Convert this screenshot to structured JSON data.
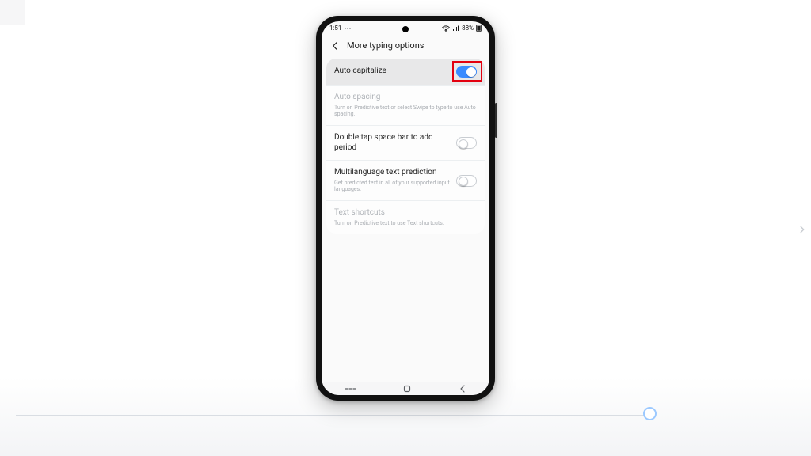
{
  "status_bar": {
    "time": "1:51",
    "battery_percent": "88%"
  },
  "header": {
    "title": "More typing options"
  },
  "settings": [
    {
      "title": "Auto capitalize",
      "subtitle": "",
      "toggle_on": true,
      "highlighted": true,
      "red_box": true,
      "disabled": false
    },
    {
      "title": "Auto spacing",
      "subtitle": "Turn on Predictive text or select Swipe to type to use Auto spacing.",
      "toggle_on": null,
      "highlighted": false,
      "red_box": false,
      "disabled": true
    },
    {
      "title": "Double tap space bar to add period",
      "subtitle": "",
      "toggle_on": false,
      "highlighted": false,
      "red_box": false,
      "disabled": false
    },
    {
      "title": "Multilanguage text prediction",
      "subtitle": "Get predicted text in all of your supported input languages.",
      "toggle_on": false,
      "highlighted": false,
      "red_box": false,
      "disabled": false
    },
    {
      "title": "Text shortcuts",
      "subtitle": "Turn on Predictive text to use Text shortcuts.",
      "toggle_on": null,
      "highlighted": false,
      "red_box": false,
      "disabled": true
    }
  ]
}
